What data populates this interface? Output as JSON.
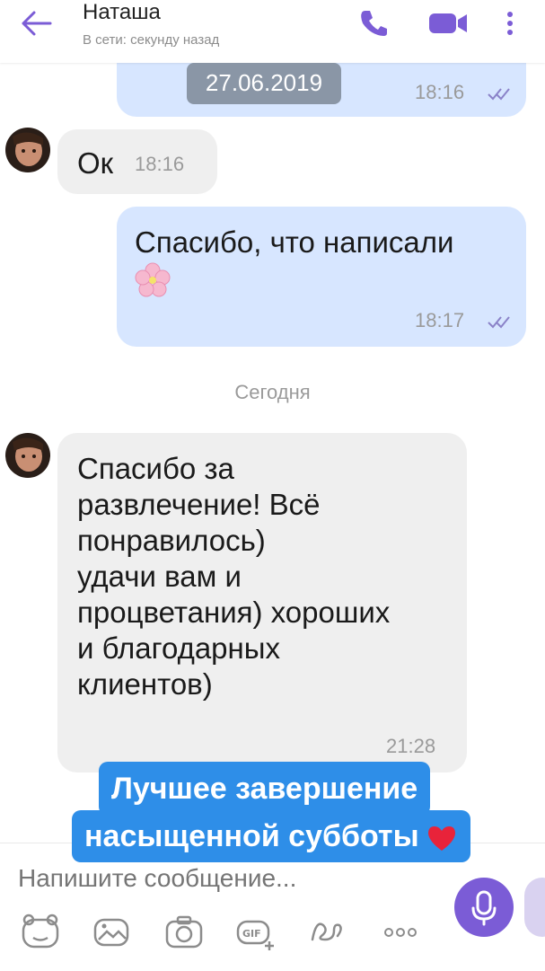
{
  "header": {
    "contact_name": "Наташа",
    "status": "В сети: секунду назад"
  },
  "messages": [
    {
      "direction": "out",
      "text": "",
      "time": "18:16"
    },
    {
      "direction": "in",
      "text": "Ок",
      "time": "18:16"
    },
    {
      "direction": "out",
      "text": "Спасибо, что написали",
      "emoji": "cherry-blossom-emoji",
      "time": "18:17"
    },
    {
      "direction": "in",
      "text_lines": [
        "Спасибо за",
        "развлечение! Всё",
        "понравилось)",
        "удачи вам и",
        "процветания) хороших",
        "и благодарных",
        "клиентов)"
      ],
      "time": "21:28"
    }
  ],
  "date_chip": "27.06.2019",
  "day_separator": "Сегодня",
  "caption": {
    "line1": "Лучшее завершение",
    "line2": "насыщенной субботы",
    "emoji": "red-heart-emoji"
  },
  "composer": {
    "placeholder": "Напишите сообщение..."
  },
  "colors": {
    "accent": "#7b5cd6",
    "outgoing_bubble": "#d7e6ff",
    "incoming_bubble": "#efefef",
    "caption_bg": "#2e8ee8"
  }
}
